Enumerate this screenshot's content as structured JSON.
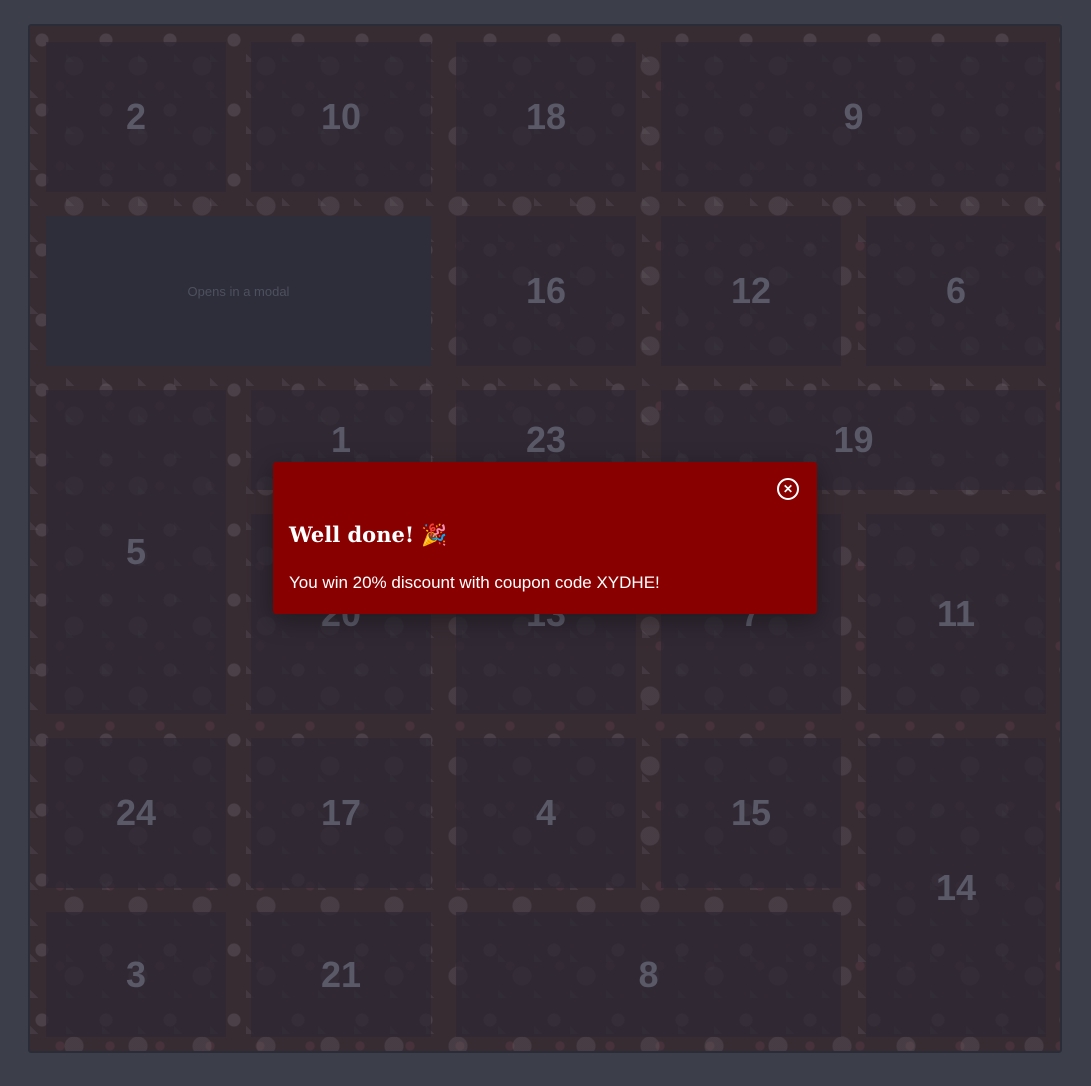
{
  "calendar": {
    "doors": [
      {
        "label": "2"
      },
      {
        "label": "10"
      },
      {
        "label": "18"
      },
      {
        "label": "9"
      },
      {
        "label": "Opens in a modal"
      },
      {
        "label": "16"
      },
      {
        "label": "12"
      },
      {
        "label": "6"
      },
      {
        "label": "5"
      },
      {
        "label": "1"
      },
      {
        "label": "23"
      },
      {
        "label": "19"
      },
      {
        "label": "20"
      },
      {
        "label": "13"
      },
      {
        "label": "7"
      },
      {
        "label": "11"
      },
      {
        "label": "24"
      },
      {
        "label": "17"
      },
      {
        "label": "4"
      },
      {
        "label": "15"
      },
      {
        "label": "14"
      },
      {
        "label": "3"
      },
      {
        "label": "21"
      },
      {
        "label": "8"
      }
    ]
  },
  "modal": {
    "title": "Well done! 🎉",
    "message": "You win 20% discount with coupon code XYDHE!",
    "close_icon": "close-circle-icon",
    "background_color": "#880000"
  }
}
